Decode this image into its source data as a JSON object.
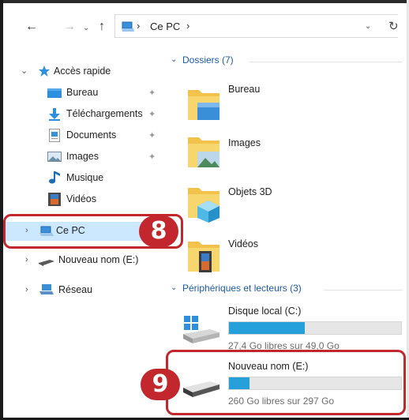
{
  "addressbar": {
    "back_icon": "arrow-left-icon",
    "forward_icon": "arrow-right-icon",
    "up_icon": "arrow-up-icon",
    "path": "Ce PC",
    "refresh_icon": "refresh-icon"
  },
  "nav": {
    "quick_access": "Accès rapide",
    "items": [
      {
        "label": "Bureau",
        "icon": "desktop-folder-icon",
        "pinned": true
      },
      {
        "label": "Téléchargements",
        "icon": "download-arrow-icon",
        "pinned": true
      },
      {
        "label": "Documents",
        "icon": "documents-icon",
        "pinned": true
      },
      {
        "label": "Images",
        "icon": "images-icon",
        "pinned": true
      },
      {
        "label": "Musique",
        "icon": "music-note-icon",
        "pinned": false
      },
      {
        "label": "Vidéos",
        "icon": "video-film-icon",
        "pinned": false
      }
    ],
    "this_pc": "Ce PC",
    "drive": "Nouveau nom (E:)",
    "network": "Réseau"
  },
  "content": {
    "folders_header": "Dossiers (7)",
    "folders": [
      {
        "name": "Bureau",
        "icon": "desktop-folder-icon"
      },
      {
        "name": "Images",
        "icon": "images-folder-icon"
      },
      {
        "name": "Objets 3D",
        "icon": "3d-objects-folder-icon"
      },
      {
        "name": "Vidéos",
        "icon": "videos-folder-icon"
      }
    ],
    "devices_header": "Périphériques et lecteurs (3)",
    "drives": [
      {
        "name": "Disque local (C:)",
        "info": "27,4 Go libres sur 49,0 Go",
        "used_fraction": 0.44,
        "icon": "windows-drive-icon"
      },
      {
        "name": "Nouveau nom (E:)",
        "info": "260 Go libres sur 297 Go",
        "used_fraction": 0.12,
        "icon": "external-drive-icon"
      }
    ]
  },
  "callouts": {
    "first": "8",
    "second": "9"
  },
  "colors": {
    "accent": "#26a0da",
    "callout": "#c1272d",
    "selection": "#cce8ff",
    "group_header": "#1e5aa8"
  }
}
